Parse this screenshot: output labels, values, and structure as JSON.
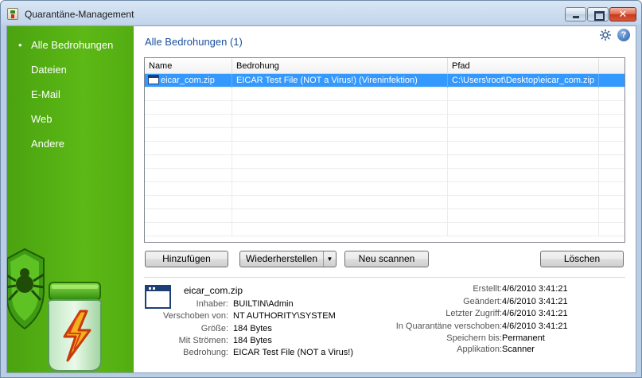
{
  "window": {
    "title": "Quarantäne-Management",
    "close_glyph": "✕"
  },
  "sidebar": {
    "items": [
      {
        "label": "Alle Bedrohungen"
      },
      {
        "label": "Dateien"
      },
      {
        "label": "E-Mail"
      },
      {
        "label": "Web"
      },
      {
        "label": "Andere"
      }
    ]
  },
  "main": {
    "title": "Alle Bedrohungen (1)",
    "help_glyph": "?",
    "table": {
      "columns": [
        "Name",
        "Bedrohung",
        "Pfad"
      ],
      "rows": [
        {
          "name": "eicar_com.zip",
          "threat": "EICAR Test File (NOT a Virus!) (Vireninfektion)",
          "path": "C:\\Users\\root\\Desktop\\eicar_com.zip"
        }
      ]
    },
    "buttons": {
      "add": "Hinzufügen",
      "restore": "Wiederherstellen",
      "restore_arrow": "▼",
      "rescan": "Neu scannen",
      "delete": "Löschen"
    },
    "details": {
      "filename": "eicar_com.zip",
      "left": [
        {
          "label": "Inhaber:",
          "value": "BUILTIN\\Admin"
        },
        {
          "label": "Verschoben von:",
          "value": "NT AUTHORITY\\SYSTEM"
        },
        {
          "label": "Größe:",
          "value": "184 Bytes"
        },
        {
          "label": "Mit Strömen:",
          "value": "184 Bytes"
        },
        {
          "label": "Bedrohung:",
          "value": "EICAR Test File (NOT a Virus!)"
        }
      ],
      "right": [
        {
          "label": "Erstellt:",
          "value": "4/6/2010 3:41:21"
        },
        {
          "label": "Geändert:",
          "value": "4/6/2010 3:41:21"
        },
        {
          "label": "Letzter Zugriff:",
          "value": "4/6/2010 3:41:21"
        },
        {
          "label": "In Quarantäne verschoben:",
          "value": "4/6/2010 3:41:21"
        },
        {
          "label": "Speichern bis:",
          "value": "Permanent"
        },
        {
          "label": "Applikation:",
          "value": "Scanner"
        }
      ]
    }
  },
  "colors": {
    "sidebar_green": "#5cb815",
    "title_blue": "#1a4f9c",
    "selection": "#3399ff"
  }
}
